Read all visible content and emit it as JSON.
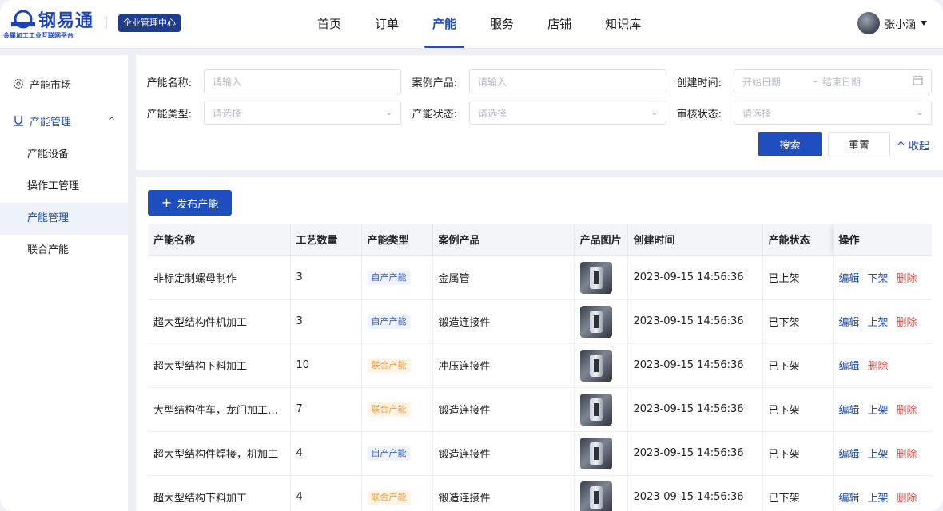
{
  "brand": {
    "title": "钢易通",
    "subtitle": "金属加工工业互联网平台",
    "center_badge": "企业管理中心",
    "color": "#1a44b8"
  },
  "nav": {
    "items": [
      "首页",
      "订单",
      "产能",
      "服务",
      "店铺",
      "知识库"
    ],
    "active": "产能"
  },
  "user": {
    "name": "张小涵"
  },
  "sidebar": {
    "market": "产能市场",
    "manage": "产能管理",
    "subitems": [
      "产能设备",
      "操作工管理",
      "产能管理",
      "联合产能"
    ],
    "active_sub": "产能管理"
  },
  "filter": {
    "name_label": "产能名称:",
    "name_placeholder": "请输入",
    "case_label": "案例产品:",
    "case_placeholder": "请输入",
    "created_label": "创建时间:",
    "start_placeholder": "开始日期",
    "range_sep": "–",
    "end_placeholder": "结束日期",
    "type_label": "产能类型:",
    "type_placeholder": "请选择",
    "status_label": "产能状态:",
    "status_placeholder": "请选择",
    "audit_label": "审核状态:",
    "audit_placeholder": "请选择",
    "search_btn": "搜索",
    "reset_btn": "重置",
    "collapse": "收起"
  },
  "table": {
    "publish_btn": "发布产能",
    "headers": [
      "产能名称",
      "工艺数量",
      "产能类型",
      "案例产品",
      "产品图片",
      "创建时间",
      "产能状态",
      "操作"
    ],
    "rows": [
      {
        "name": "非标定制螺母制作",
        "count": "3",
        "type": "自产产能",
        "type_kind": "self",
        "case": "金属管",
        "time": "2023-09-15 14:56:36",
        "status": "已上架",
        "actions": [
          "编辑",
          "下架",
          "删除"
        ]
      },
      {
        "name": "超大型结构件机加工",
        "count": "3",
        "type": "自产产能",
        "type_kind": "self",
        "case": "锻造连接件",
        "time": "2023-09-15 14:56:36",
        "status": "已下架",
        "actions": [
          "编辑",
          "上架",
          "删除"
        ]
      },
      {
        "name": "超大型结构下料加工",
        "count": "10",
        "type": "联合产能",
        "type_kind": "joint",
        "case": "冲压连接件",
        "time": "2023-09-15 14:56:36",
        "status": "已下架",
        "actions": [
          "编辑",
          "删除"
        ]
      },
      {
        "name": "大型结构件车，龙门加工…",
        "count": "7",
        "type": "联合产能",
        "type_kind": "joint",
        "case": "锻造连接件",
        "time": "2023-09-15 14:56:36",
        "status": "已下架",
        "actions": [
          "编辑",
          "上架",
          "删除"
        ]
      },
      {
        "name": "超大型结构件焊接，机加工",
        "count": "4",
        "type": "自产产能",
        "type_kind": "self",
        "case": "锻造连接件",
        "time": "2023-09-15 14:56:36",
        "status": "已下架",
        "actions": [
          "编辑",
          "上架",
          "删除"
        ]
      },
      {
        "name": "超大型结构下料加工",
        "count": "4",
        "type": "联合产能",
        "type_kind": "joint",
        "case": "锻造连接件",
        "time": "2023-09-15 14:56:36",
        "status": "已下架",
        "actions": [
          "编辑",
          "上架",
          "删除"
        ]
      }
    ]
  },
  "colors": {
    "primary": "#1f4fbf",
    "danger": "#e5463f",
    "joint_tag": "#f0a040"
  }
}
